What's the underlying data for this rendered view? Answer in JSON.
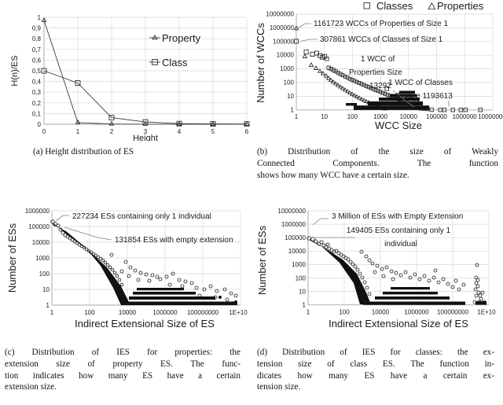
{
  "figure": {
    "panels": [
      {
        "id": "a",
        "caption_lines": [
          "(a) Height distribution of ES"
        ],
        "chart_data": {
          "type": "line",
          "title": "",
          "xlabel": "Height",
          "ylabel": "H(n)/ES",
          "x": [
            0,
            1,
            2,
            3,
            4,
            5,
            6
          ],
          "xticklabels": [
            "0",
            "1",
            "2",
            "3",
            "4",
            "5",
            "6"
          ],
          "yticklabels": [
            "0",
            "0,1",
            "0,2",
            "0,3",
            "0,4",
            "0,5",
            "0,6",
            "0,7",
            "0,8",
            "0,9",
            "1"
          ],
          "ylim": [
            0,
            1
          ],
          "xlim": [
            0,
            6
          ],
          "grid": true,
          "legend_position": "inside-right",
          "series": [
            {
              "name": "Property",
              "marker": "triangle",
              "values": [
                0.97,
                0.015,
                0.002,
                0.001,
                0.001,
                0.0005,
                0.0005
              ]
            },
            {
              "name": "Class",
              "marker": "square",
              "values": [
                0.5,
                0.385,
                0.062,
                0.021,
                0.006,
                0.003,
                0.002
              ]
            }
          ]
        }
      },
      {
        "id": "b",
        "caption_lines": [
          "(b) Distribution of the size of Weakly",
          "Connected Components. The function",
          "shows how many WCC have a certain size."
        ],
        "chart_data": {
          "type": "scatter",
          "title": "",
          "xlabel": "WCC Size",
          "ylabel": "Number of WCCs",
          "xticklabels": [
            "1",
            "10",
            "100",
            "1000",
            "10000",
            "100000",
            "1000000",
            "10000000"
          ],
          "yticklabels": [
            "1",
            "10",
            "100",
            "1000",
            "10000",
            "100000",
            "1000000",
            "10000000"
          ],
          "xlim": [
            1,
            10000000
          ],
          "ylim": [
            1,
            10000000
          ],
          "xscale": "log",
          "yscale": "log",
          "grid": true,
          "legend_position": "top",
          "legend": [
            {
              "name": "Classes",
              "marker": "square"
            },
            {
              "name": "Properties",
              "marker": "triangle"
            }
          ],
          "annotations": [
            {
              "text": "1161723 WCCs of Properties of Size 1",
              "points_to": {
                "x": 1,
                "y": 1161723
              }
            },
            {
              "text": "307861 WCCs of Classes of Size 1",
              "points_to": {
                "x": 1,
                "y": 307861
              }
            },
            {
              "text": "1 WCC of",
              "points_to": null
            },
            {
              "text": "Properties Size",
              "points_to": null
            },
            {
              "text": "13292",
              "points_to": {
                "x": 13292,
                "y": 1
              }
            },
            {
              "text": "1 WCC of Classes",
              "points_to": null
            },
            {
              "text": "of Size 1193613",
              "points_to": {
                "x": 1193613,
                "y": 1
              }
            }
          ]
        }
      },
      {
        "id": "c",
        "caption_lines": [
          "(c) Distribution of IES for properties: the",
          "extension size of property ES. The func-",
          "tion indicates how many ES have a certain",
          "extension size."
        ],
        "chart_data": {
          "type": "scatter",
          "title": "",
          "xlabel": "Indirect Extensional Size of ES",
          "ylabel": "Number of ESs",
          "xticklabels": [
            "1",
            "100",
            "10000",
            "1000000",
            "100000000",
            "1E+10"
          ],
          "yticklabels": [
            "1",
            "10",
            "100",
            "1000",
            "10000",
            "100000",
            "1000000"
          ],
          "xlim": [
            1,
            10000000000
          ],
          "ylim": [
            1,
            1000000
          ],
          "xscale": "log",
          "yscale": "log",
          "grid": true,
          "annotations": [
            {
              "text": "227234  ESs containing only 1 individual",
              "points_to": {
                "x": 1,
                "y": 227234
              }
            },
            {
              "text": "131854 ESs with empty extension",
              "points_to": {
                "x": 1,
                "y": 131854
              }
            }
          ]
        }
      },
      {
        "id": "d",
        "caption_lines": [
          "(d) Distribution of IES for classes: the ex-",
          "tension size of class ES. The function in-",
          "dicates how many ES have a certain ex-",
          "tension size."
        ],
        "chart_data": {
          "type": "scatter",
          "title": "",
          "xlabel": "Indirect Extensional Size of ES",
          "ylabel": "Number of ESs",
          "xticklabels": [
            "1",
            "100",
            "10000",
            "1000000",
            "100000000",
            "1E+10"
          ],
          "yticklabels": [
            "1",
            "10",
            "100",
            "1000",
            "10000",
            "100000",
            "1000000",
            "10000000"
          ],
          "xlim": [
            1,
            10000000000
          ],
          "ylim": [
            1,
            10000000
          ],
          "xscale": "log",
          "yscale": "log",
          "grid": true,
          "annotations": [
            {
              "text": "3 Million of ESs with Empty Extension",
              "points_to": {
                "x": 1,
                "y": 3000000
              }
            },
            {
              "text": "149405 ESs containing only 1",
              "points_to": {
                "x": 1,
                "y": 149405
              }
            },
            {
              "text": "individual",
              "points_to": null
            }
          ]
        }
      }
    ]
  }
}
